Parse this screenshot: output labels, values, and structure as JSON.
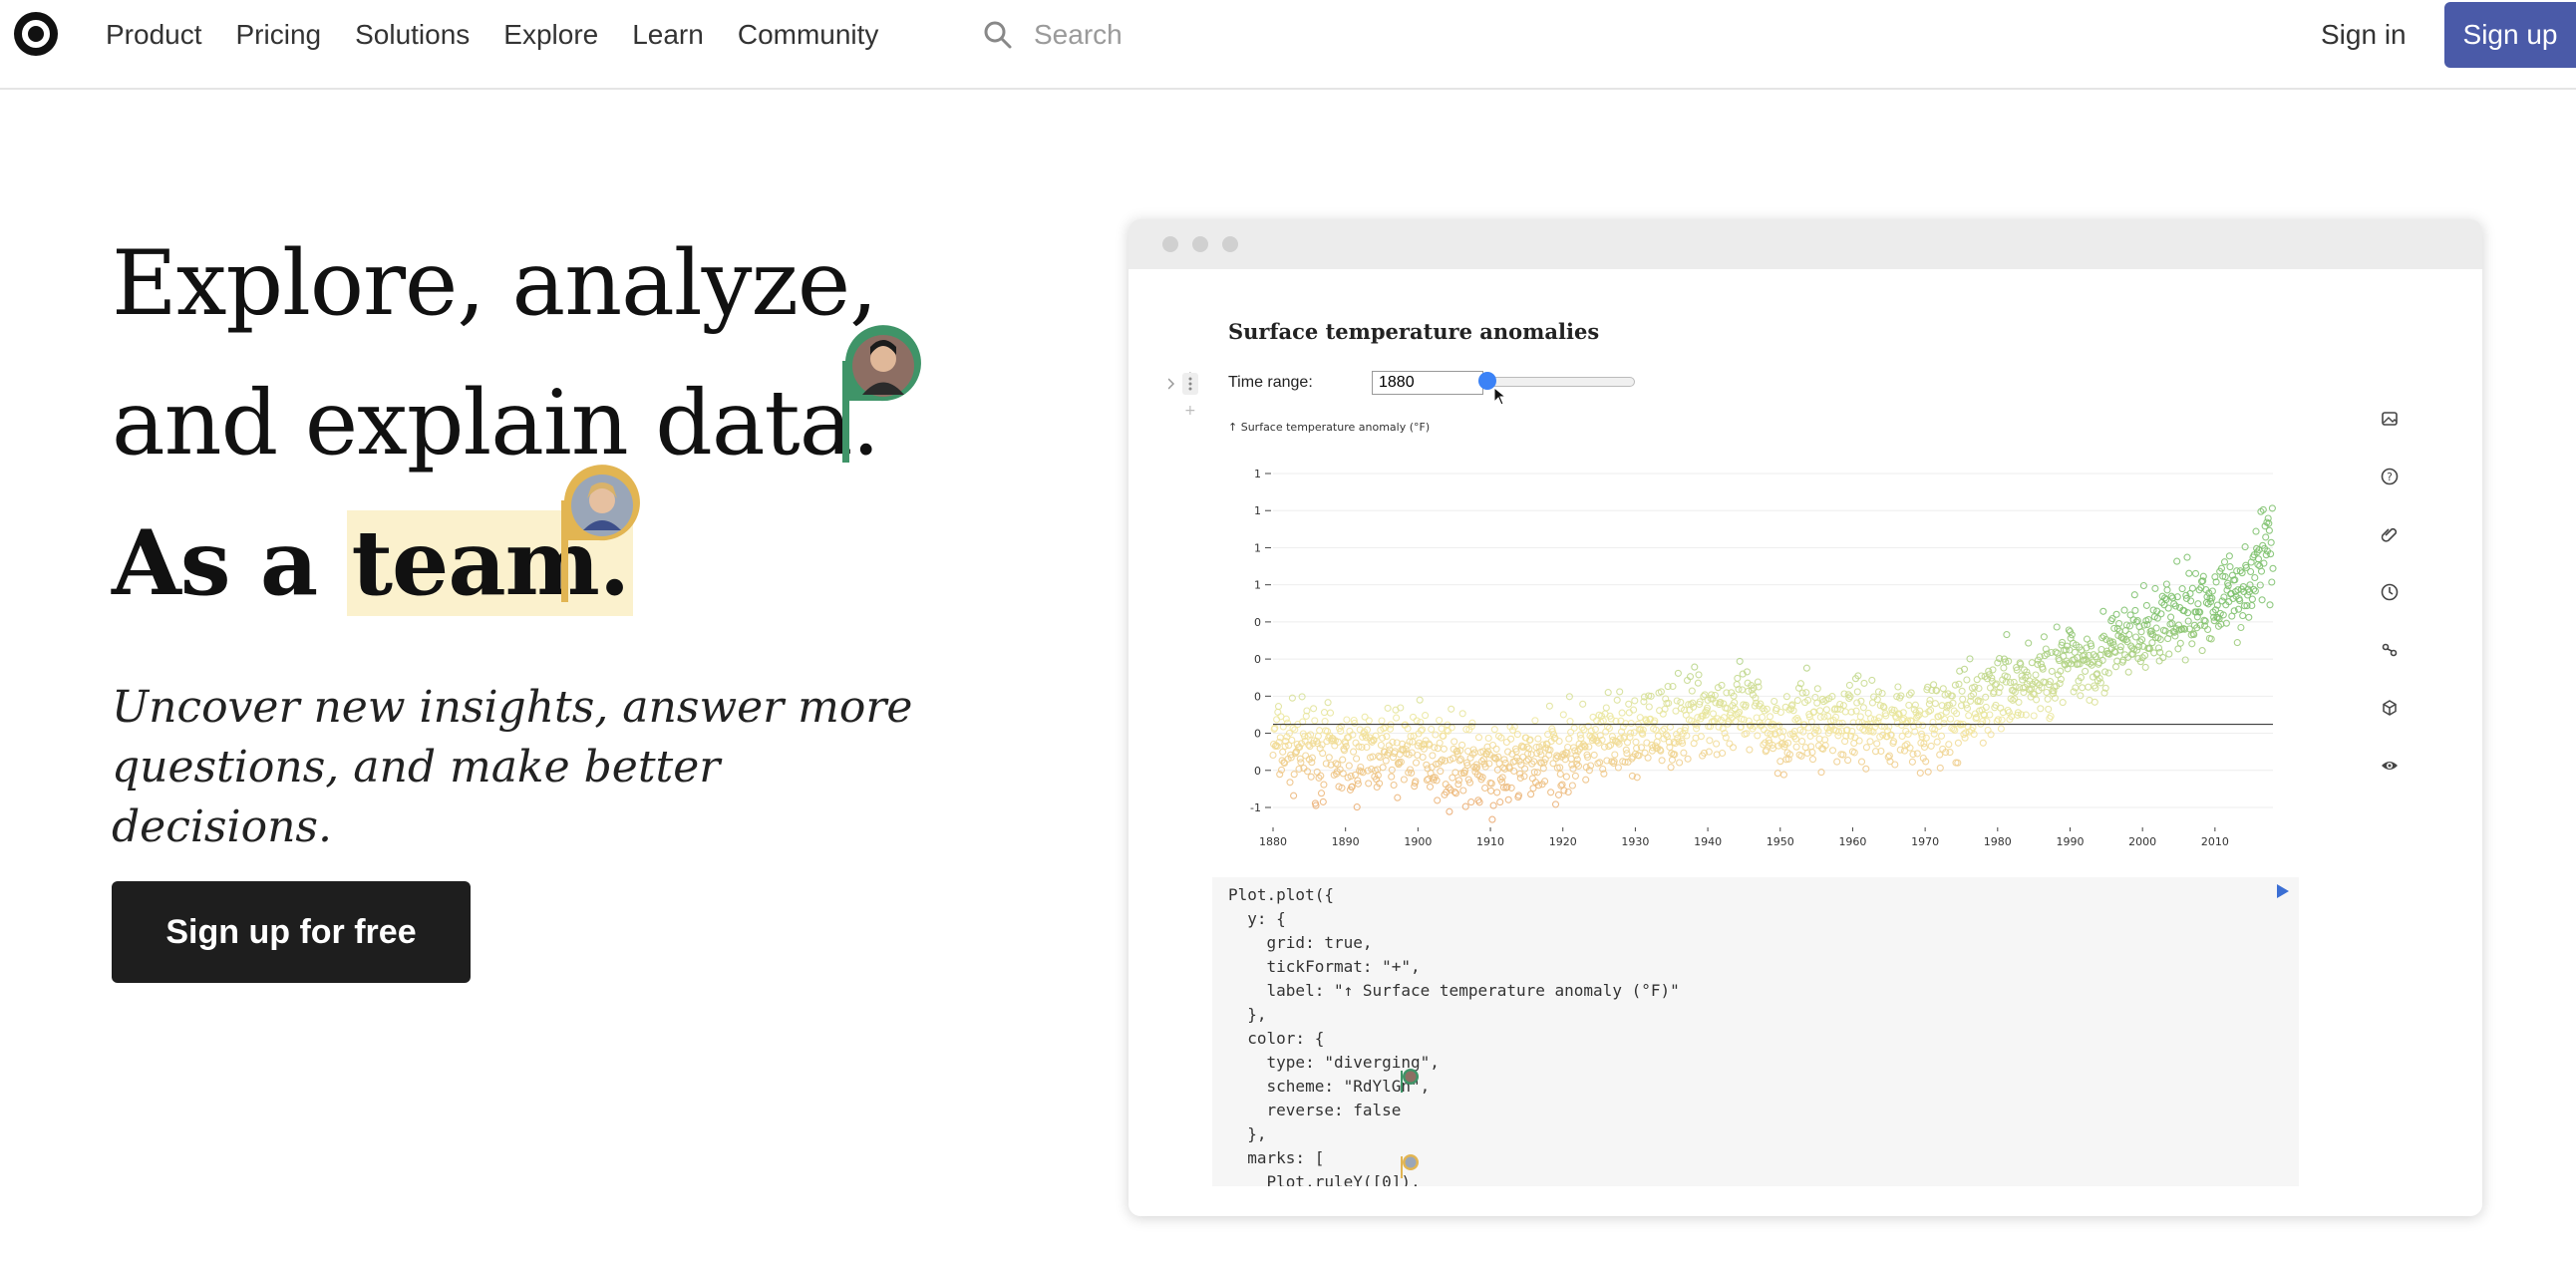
{
  "nav": {
    "links": [
      "Product",
      "Pricing",
      "Solutions",
      "Explore",
      "Learn",
      "Community"
    ],
    "search_placeholder": "Search",
    "signin_label": "Sign in",
    "signup_label": "Sign up"
  },
  "hero": {
    "line1": "Explore, analyze,",
    "line2": "and explain data.",
    "line3_prefix": "As a ",
    "line3_highlight": "team.",
    "subtitle": "Uncover new insights, answer more questions, and make better decisions.",
    "cta_label": "Sign up for free"
  },
  "notebook": {
    "title": "Surface temperature anomalies",
    "time_range_label": "Time range:",
    "time_range_value": "1880",
    "slider_value": 0,
    "code_lines": [
      "Plot.plot({",
      "  y: {",
      "    grid: true,",
      "    tickFormat: \"+\",",
      "    label: \"↑ Surface temperature anomaly (°F)\"",
      "  },",
      "  color: {",
      "    type: \"diverging\",",
      "    scheme: \"RdYlGn\",",
      "    reverse: false",
      "  },",
      "  marks: [",
      "    Plot.ruleY([0]),"
    ],
    "right_icons": [
      "image-icon",
      "help-icon",
      "attachment-icon",
      "history-icon",
      "link-icon",
      "cube-icon",
      "eye-icon"
    ]
  },
  "chart_data": {
    "type": "scatter",
    "title": "",
    "ylabel": "↑ Surface temperature anomaly (°F)",
    "xlabel": "",
    "x_ticks": [
      1880,
      1890,
      1900,
      1910,
      1920,
      1930,
      1940,
      1950,
      1960,
      1970,
      1980,
      1990,
      2000,
      2010
    ],
    "y_ticks": [
      -1,
      0,
      0,
      0,
      0,
      0,
      1,
      1,
      1,
      1
    ],
    "x_range": [
      1880,
      2018
    ],
    "y_range": [
      -1.0,
      2.8
    ],
    "grid": true,
    "rule_y": 0,
    "color_scheme": "RdYlGn",
    "color_type": "diverging",
    "trend_points": [
      [
        1880,
        -0.2
      ],
      [
        1890,
        -0.35
      ],
      [
        1900,
        -0.25
      ],
      [
        1910,
        -0.5
      ],
      [
        1915,
        -0.4
      ],
      [
        1920,
        -0.3
      ],
      [
        1930,
        -0.15
      ],
      [
        1940,
        0.15
      ],
      [
        1945,
        0.1
      ],
      [
        1950,
        -0.05
      ],
      [
        1960,
        0.05
      ],
      [
        1970,
        0.0
      ],
      [
        1975,
        0.05
      ],
      [
        1980,
        0.35
      ],
      [
        1985,
        0.45
      ],
      [
        1990,
        0.65
      ],
      [
        1995,
        0.75
      ],
      [
        2000,
        0.95
      ],
      [
        2005,
        1.15
      ],
      [
        2010,
        1.3
      ],
      [
        2015,
        1.55
      ],
      [
        2017,
        1.9
      ]
    ]
  },
  "colors": {
    "accent": "#4a5aa8",
    "highlight": "#fbf1cd",
    "cta": "#1e1e1e",
    "pin_green": "#3f9468",
    "pin_gold": "#e2b552",
    "cold": "#e9a46a",
    "neutral": "#f3e9a0",
    "warm": "#7bbf6a"
  }
}
